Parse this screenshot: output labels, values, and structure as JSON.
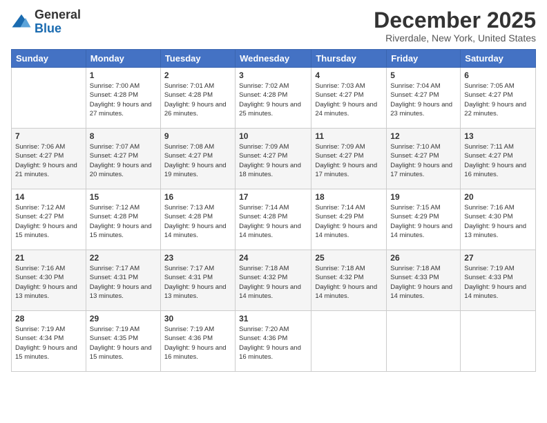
{
  "logo": {
    "general": "General",
    "blue": "Blue"
  },
  "title": "December 2025",
  "subtitle": "Riverdale, New York, United States",
  "days_header": [
    "Sunday",
    "Monday",
    "Tuesday",
    "Wednesday",
    "Thursday",
    "Friday",
    "Saturday"
  ],
  "weeks": [
    [
      {
        "day": "",
        "sunrise": "",
        "sunset": "",
        "daylight": ""
      },
      {
        "day": "1",
        "sunrise": "Sunrise: 7:00 AM",
        "sunset": "Sunset: 4:28 PM",
        "daylight": "Daylight: 9 hours and 27 minutes."
      },
      {
        "day": "2",
        "sunrise": "Sunrise: 7:01 AM",
        "sunset": "Sunset: 4:28 PM",
        "daylight": "Daylight: 9 hours and 26 minutes."
      },
      {
        "day": "3",
        "sunrise": "Sunrise: 7:02 AM",
        "sunset": "Sunset: 4:28 PM",
        "daylight": "Daylight: 9 hours and 25 minutes."
      },
      {
        "day": "4",
        "sunrise": "Sunrise: 7:03 AM",
        "sunset": "Sunset: 4:27 PM",
        "daylight": "Daylight: 9 hours and 24 minutes."
      },
      {
        "day": "5",
        "sunrise": "Sunrise: 7:04 AM",
        "sunset": "Sunset: 4:27 PM",
        "daylight": "Daylight: 9 hours and 23 minutes."
      },
      {
        "day": "6",
        "sunrise": "Sunrise: 7:05 AM",
        "sunset": "Sunset: 4:27 PM",
        "daylight": "Daylight: 9 hours and 22 minutes."
      }
    ],
    [
      {
        "day": "7",
        "sunrise": "Sunrise: 7:06 AM",
        "sunset": "Sunset: 4:27 PM",
        "daylight": "Daylight: 9 hours and 21 minutes."
      },
      {
        "day": "8",
        "sunrise": "Sunrise: 7:07 AM",
        "sunset": "Sunset: 4:27 PM",
        "daylight": "Daylight: 9 hours and 20 minutes."
      },
      {
        "day": "9",
        "sunrise": "Sunrise: 7:08 AM",
        "sunset": "Sunset: 4:27 PM",
        "daylight": "Daylight: 9 hours and 19 minutes."
      },
      {
        "day": "10",
        "sunrise": "Sunrise: 7:09 AM",
        "sunset": "Sunset: 4:27 PM",
        "daylight": "Daylight: 9 hours and 18 minutes."
      },
      {
        "day": "11",
        "sunrise": "Sunrise: 7:09 AM",
        "sunset": "Sunset: 4:27 PM",
        "daylight": "Daylight: 9 hours and 17 minutes."
      },
      {
        "day": "12",
        "sunrise": "Sunrise: 7:10 AM",
        "sunset": "Sunset: 4:27 PM",
        "daylight": "Daylight: 9 hours and 17 minutes."
      },
      {
        "day": "13",
        "sunrise": "Sunrise: 7:11 AM",
        "sunset": "Sunset: 4:27 PM",
        "daylight": "Daylight: 9 hours and 16 minutes."
      }
    ],
    [
      {
        "day": "14",
        "sunrise": "Sunrise: 7:12 AM",
        "sunset": "Sunset: 4:27 PM",
        "daylight": "Daylight: 9 hours and 15 minutes."
      },
      {
        "day": "15",
        "sunrise": "Sunrise: 7:12 AM",
        "sunset": "Sunset: 4:28 PM",
        "daylight": "Daylight: 9 hours and 15 minutes."
      },
      {
        "day": "16",
        "sunrise": "Sunrise: 7:13 AM",
        "sunset": "Sunset: 4:28 PM",
        "daylight": "Daylight: 9 hours and 14 minutes."
      },
      {
        "day": "17",
        "sunrise": "Sunrise: 7:14 AM",
        "sunset": "Sunset: 4:28 PM",
        "daylight": "Daylight: 9 hours and 14 minutes."
      },
      {
        "day": "18",
        "sunrise": "Sunrise: 7:14 AM",
        "sunset": "Sunset: 4:29 PM",
        "daylight": "Daylight: 9 hours and 14 minutes."
      },
      {
        "day": "19",
        "sunrise": "Sunrise: 7:15 AM",
        "sunset": "Sunset: 4:29 PM",
        "daylight": "Daylight: 9 hours and 14 minutes."
      },
      {
        "day": "20",
        "sunrise": "Sunrise: 7:16 AM",
        "sunset": "Sunset: 4:30 PM",
        "daylight": "Daylight: 9 hours and 13 minutes."
      }
    ],
    [
      {
        "day": "21",
        "sunrise": "Sunrise: 7:16 AM",
        "sunset": "Sunset: 4:30 PM",
        "daylight": "Daylight: 9 hours and 13 minutes."
      },
      {
        "day": "22",
        "sunrise": "Sunrise: 7:17 AM",
        "sunset": "Sunset: 4:31 PM",
        "daylight": "Daylight: 9 hours and 13 minutes."
      },
      {
        "day": "23",
        "sunrise": "Sunrise: 7:17 AM",
        "sunset": "Sunset: 4:31 PM",
        "daylight": "Daylight: 9 hours and 13 minutes."
      },
      {
        "day": "24",
        "sunrise": "Sunrise: 7:18 AM",
        "sunset": "Sunset: 4:32 PM",
        "daylight": "Daylight: 9 hours and 14 minutes."
      },
      {
        "day": "25",
        "sunrise": "Sunrise: 7:18 AM",
        "sunset": "Sunset: 4:32 PM",
        "daylight": "Daylight: 9 hours and 14 minutes."
      },
      {
        "day": "26",
        "sunrise": "Sunrise: 7:18 AM",
        "sunset": "Sunset: 4:33 PM",
        "daylight": "Daylight: 9 hours and 14 minutes."
      },
      {
        "day": "27",
        "sunrise": "Sunrise: 7:19 AM",
        "sunset": "Sunset: 4:33 PM",
        "daylight": "Daylight: 9 hours and 14 minutes."
      }
    ],
    [
      {
        "day": "28",
        "sunrise": "Sunrise: 7:19 AM",
        "sunset": "Sunset: 4:34 PM",
        "daylight": "Daylight: 9 hours and 15 minutes."
      },
      {
        "day": "29",
        "sunrise": "Sunrise: 7:19 AM",
        "sunset": "Sunset: 4:35 PM",
        "daylight": "Daylight: 9 hours and 15 minutes."
      },
      {
        "day": "30",
        "sunrise": "Sunrise: 7:19 AM",
        "sunset": "Sunset: 4:36 PM",
        "daylight": "Daylight: 9 hours and 16 minutes."
      },
      {
        "day": "31",
        "sunrise": "Sunrise: 7:20 AM",
        "sunset": "Sunset: 4:36 PM",
        "daylight": "Daylight: 9 hours and 16 minutes."
      },
      {
        "day": "",
        "sunrise": "",
        "sunset": "",
        "daylight": ""
      },
      {
        "day": "",
        "sunrise": "",
        "sunset": "",
        "daylight": ""
      },
      {
        "day": "",
        "sunrise": "",
        "sunset": "",
        "daylight": ""
      }
    ]
  ]
}
